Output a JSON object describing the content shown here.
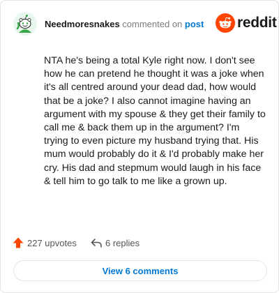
{
  "comment": {
    "username": "Needmoresnakes",
    "action_text": "commented on",
    "target_text": "post",
    "body": "NTA he's being a total Kyle right now. I don't see how he can pretend he thought it was a joke when it's all centred around your dead dad, how would that be a joke? I also cannot imagine having an argument with my spouse & they get their family to call me & back them up in the argument? I'm trying to even picture my husband trying that. His mum would probably do it & I'd probably make her cry. His dad and stepmum would laugh in his face & tell him to go talk to me like a grown up."
  },
  "brand": {
    "wordmark": "reddit",
    "accent_color": "#ff4500"
  },
  "footer": {
    "upvotes_label": "227 upvotes",
    "replies_label": "6 replies"
  },
  "view_button_label": "View 6 comments",
  "icons": {
    "avatar": "snoo-avatar",
    "logo": "reddit-logo-icon",
    "upvote": "upvote-arrow-icon",
    "reply": "reply-arrow-icon"
  },
  "colors": {
    "link": "#0079d3",
    "upvote": "#ff4500",
    "muted": "#7c7c7c",
    "border": "#e2e2e2"
  }
}
